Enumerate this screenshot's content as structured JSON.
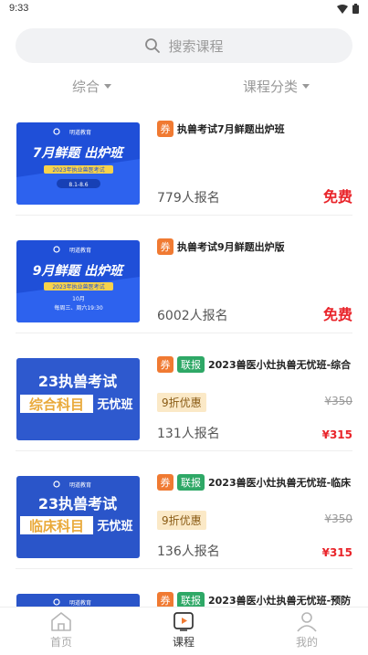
{
  "status_bar": {
    "time": "9:33"
  },
  "search": {
    "placeholder": "搜索课程"
  },
  "filters": [
    {
      "label": "综合"
    },
    {
      "label": "课程分类"
    }
  ],
  "courses": [
    {
      "title": "执兽考试7月鲜题出炉班",
      "coupon": "券",
      "enroll": "779人报名",
      "price": "免费",
      "thumb": {
        "headline": "7月鲜题 出炉班",
        "sub": "2023年执业兽医考试",
        "date": "8.1-8.6",
        "bg": "#1f4fd8",
        "logo": "明道教育"
      }
    },
    {
      "title": "执兽考试9月鲜题出炉版",
      "coupon": "券",
      "enroll": "6002人报名",
      "price": "免费",
      "thumb": {
        "headline": "9月鲜题 出炉班",
        "sub": "2023年执业兽医考试",
        "date": "10月",
        "date2": "每周三、周六19:30",
        "bg": "#1f4fd8",
        "logo": "明道教育"
      }
    },
    {
      "title": "2023兽医小灶执兽无忧班-综合",
      "coupon": "券",
      "tag": "联报",
      "discount": "9折优惠",
      "orig_price": "¥350",
      "enroll": "131人报名",
      "price": "¥315",
      "thumb": {
        "headline": "23执兽考试",
        "sub_strip": "综合科目",
        "suffix": "无忧班",
        "bg": "#2a55c9"
      }
    },
    {
      "title": "2023兽医小灶执兽无忧班-临床",
      "coupon": "券",
      "tag": "联报",
      "discount": "9折优惠",
      "orig_price": "¥350",
      "enroll": "136人报名",
      "price": "¥315",
      "thumb": {
        "headline": "23执兽考试",
        "sub_strip": "临床科目",
        "suffix": "无忧班",
        "bg": "#2a55c9",
        "logo": "明道教育"
      }
    },
    {
      "title": "2023兽医小灶执兽无忧班-预防",
      "coupon": "券",
      "tag": "联报",
      "thumb": {
        "bg": "#2a55c9",
        "logo": "明道教育"
      }
    }
  ],
  "tab_bar": {
    "items": [
      {
        "label": "首页",
        "icon": "home-icon"
      },
      {
        "label": "课程",
        "icon": "course-play-icon"
      },
      {
        "label": "我的",
        "icon": "user-icon"
      }
    ],
    "active": "课程",
    "accent": "#f07a32"
  },
  "colors": {
    "price_red": "#e9242a",
    "coupon_orange": "#f07a32",
    "lianbao_green": "#2ea866",
    "banner_blue": "#1f4fd8"
  }
}
